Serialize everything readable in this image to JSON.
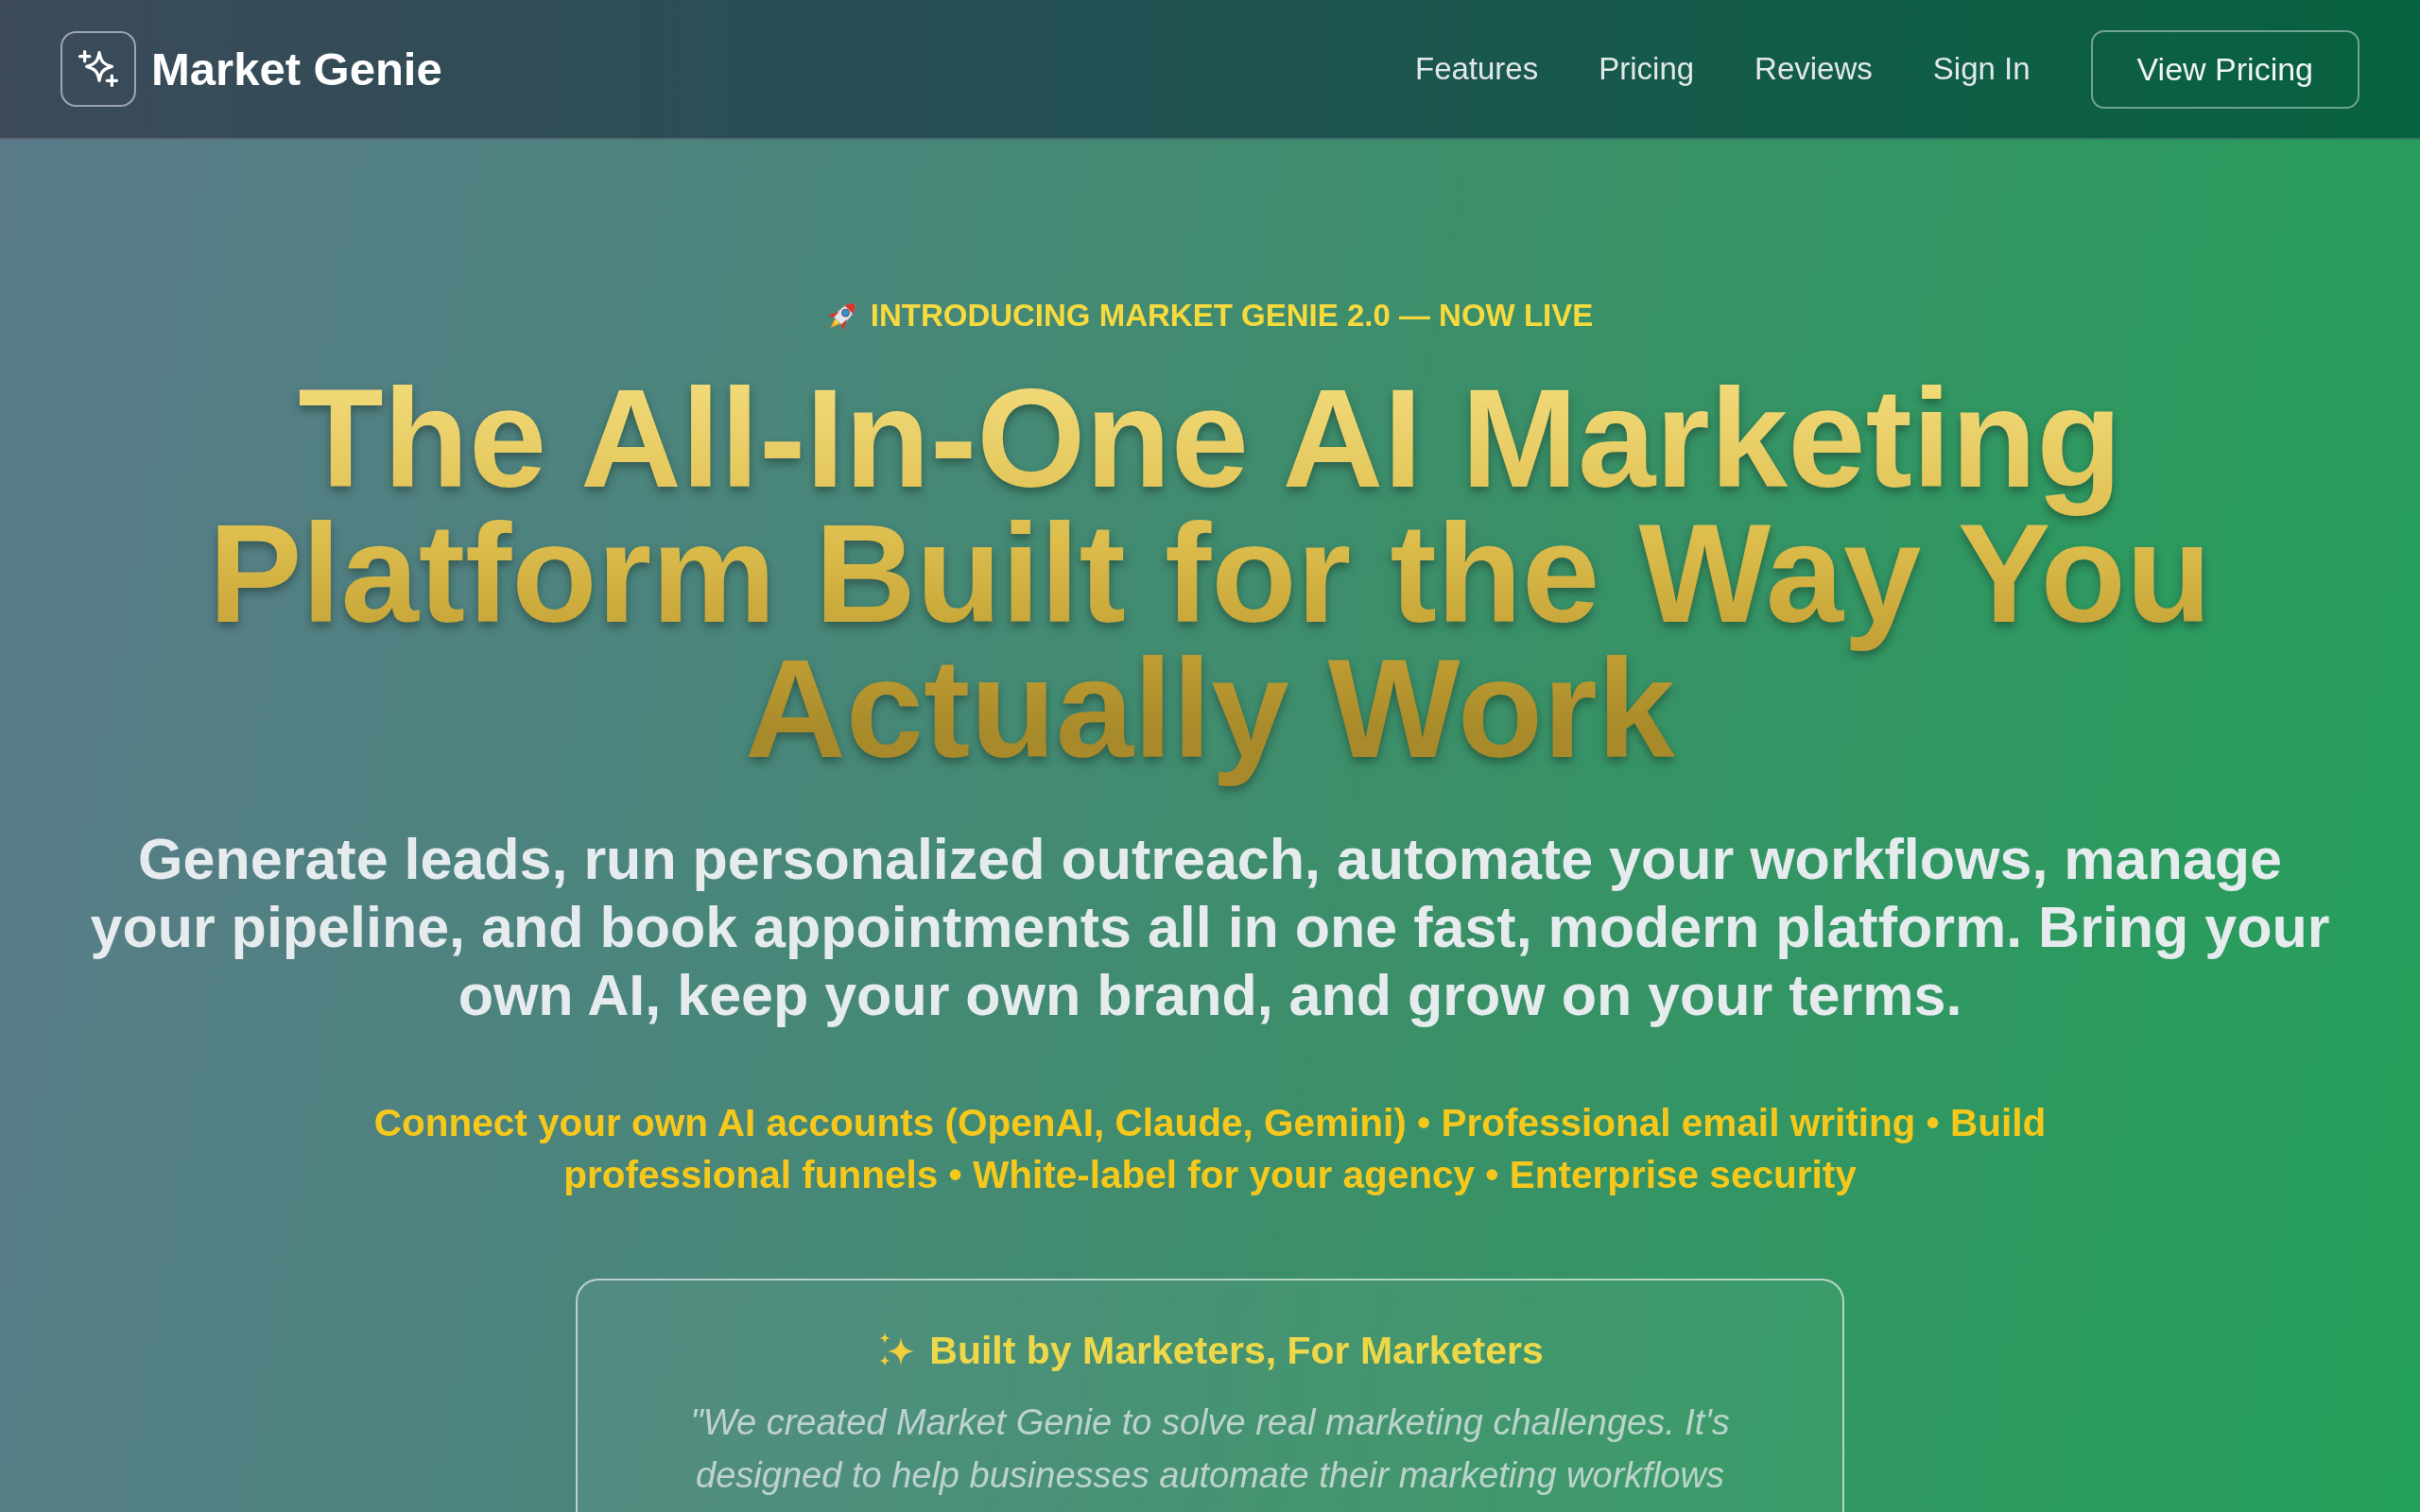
{
  "header": {
    "brand": "Market Genie",
    "nav": [
      "Features",
      "Pricing",
      "Reviews",
      "Sign In"
    ],
    "cta": "View Pricing"
  },
  "hero": {
    "eyebrow": "INTRODUCING MARKET GENIE 2.0 — NOW LIVE",
    "headline": "The All-In-One AI Marketing Platform Built for the Way You Actually Work",
    "subtitle": "Generate leads, run personalized outreach, automate your workflows, manage your pipeline, and book appointments all in one fast, modern platform. Bring your own AI, keep your own brand, and grow on your terms.",
    "features": "Connect your own AI accounts (OpenAI, Claude, Gemini) • Professional email writing • Build professional funnels • White-label for your agency • Enterprise security"
  },
  "founder_card": {
    "title": "Built by Marketers, For Marketers",
    "quote": "\"We created Market Genie to solve real marketing challenges. It's designed to help businesses automate their marketing workflows"
  }
}
